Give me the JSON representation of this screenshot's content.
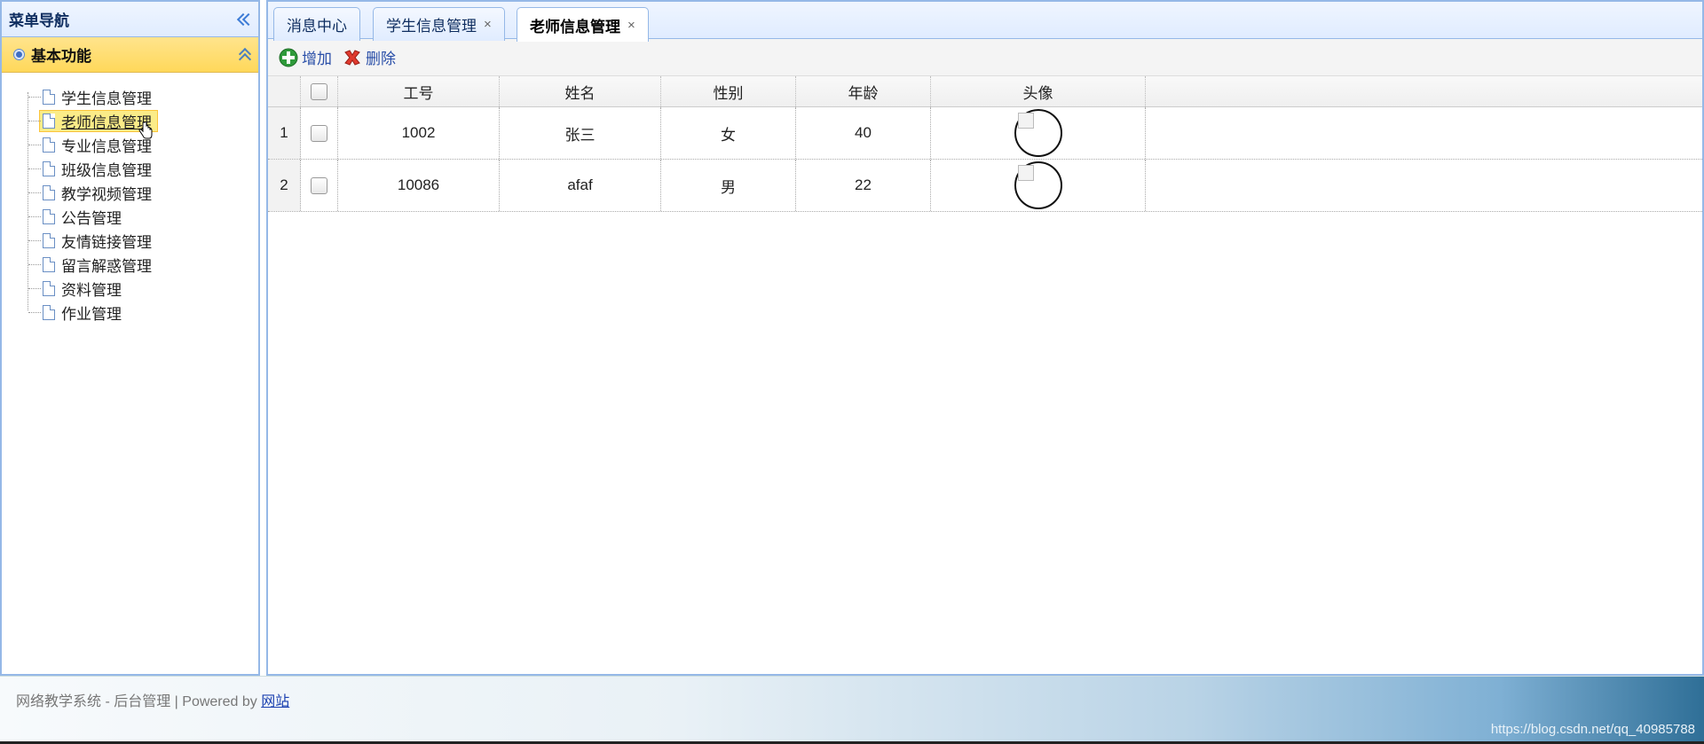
{
  "sidebar": {
    "title": "菜单导航",
    "panel_title": "基本功能",
    "items": [
      {
        "label": "学生信息管理"
      },
      {
        "label": "老师信息管理"
      },
      {
        "label": "专业信息管理"
      },
      {
        "label": "班级信息管理"
      },
      {
        "label": "教学视频管理"
      },
      {
        "label": "公告管理"
      },
      {
        "label": "友情链接管理"
      },
      {
        "label": "留言解惑管理"
      },
      {
        "label": "资料管理"
      },
      {
        "label": "作业管理"
      }
    ],
    "selected_index": 1
  },
  "tabs": [
    {
      "label": "消息中心",
      "closable": false
    },
    {
      "label": "学生信息管理",
      "closable": true
    },
    {
      "label": "老师信息管理",
      "closable": true,
      "active": true
    }
  ],
  "tab_close_glyph": "×",
  "toolbar": {
    "add_label": "增加",
    "delete_label": "删除"
  },
  "grid": {
    "columns": [
      "工号",
      "姓名",
      "性别",
      "年龄",
      "头像"
    ],
    "rows": [
      {
        "num": "1",
        "id": "1002",
        "name": "张三",
        "sex": "女",
        "age": "40"
      },
      {
        "num": "2",
        "id": "10086",
        "name": "afaf",
        "sex": "男",
        "age": "22"
      }
    ]
  },
  "footer": {
    "text": "网络教学系统  -  后台管理 | Powered by ",
    "link": "网站",
    "watermark": "https://blog.csdn.net/qq_40985788"
  },
  "colors": {
    "accent": "#95b8e7",
    "highlight": "#fbec88",
    "panel": "#ffd85a"
  }
}
